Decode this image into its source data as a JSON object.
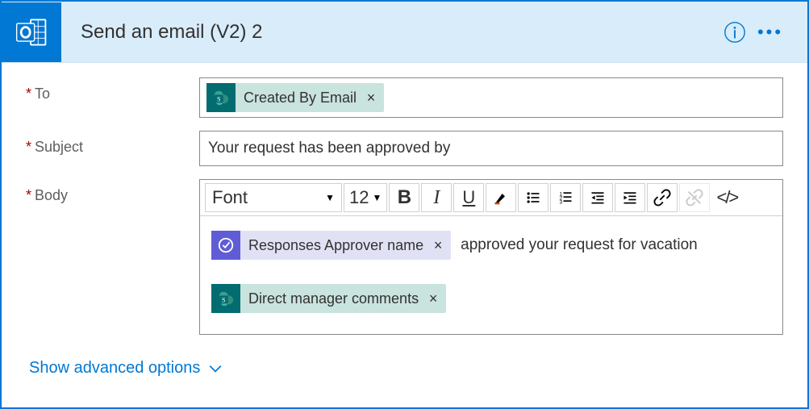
{
  "header": {
    "title": "Send an email (V2) 2"
  },
  "labels": {
    "to": "To",
    "subject": "Subject",
    "body": "Body"
  },
  "to": {
    "tokens": [
      {
        "label": "Created By Email",
        "source": "sharepoint"
      }
    ]
  },
  "subject": {
    "value": "Your request has been approved by"
  },
  "toolbar": {
    "font": "Font",
    "size": "12"
  },
  "body": {
    "parts": [
      {
        "type": "token",
        "source": "approval",
        "label": "Responses Approver name"
      },
      {
        "type": "text",
        "text": " approved your request for vacation"
      },
      {
        "type": "break"
      },
      {
        "type": "token",
        "source": "sharepoint",
        "label": "Direct manager comments"
      }
    ]
  },
  "advanced": {
    "label": "Show advanced options"
  }
}
